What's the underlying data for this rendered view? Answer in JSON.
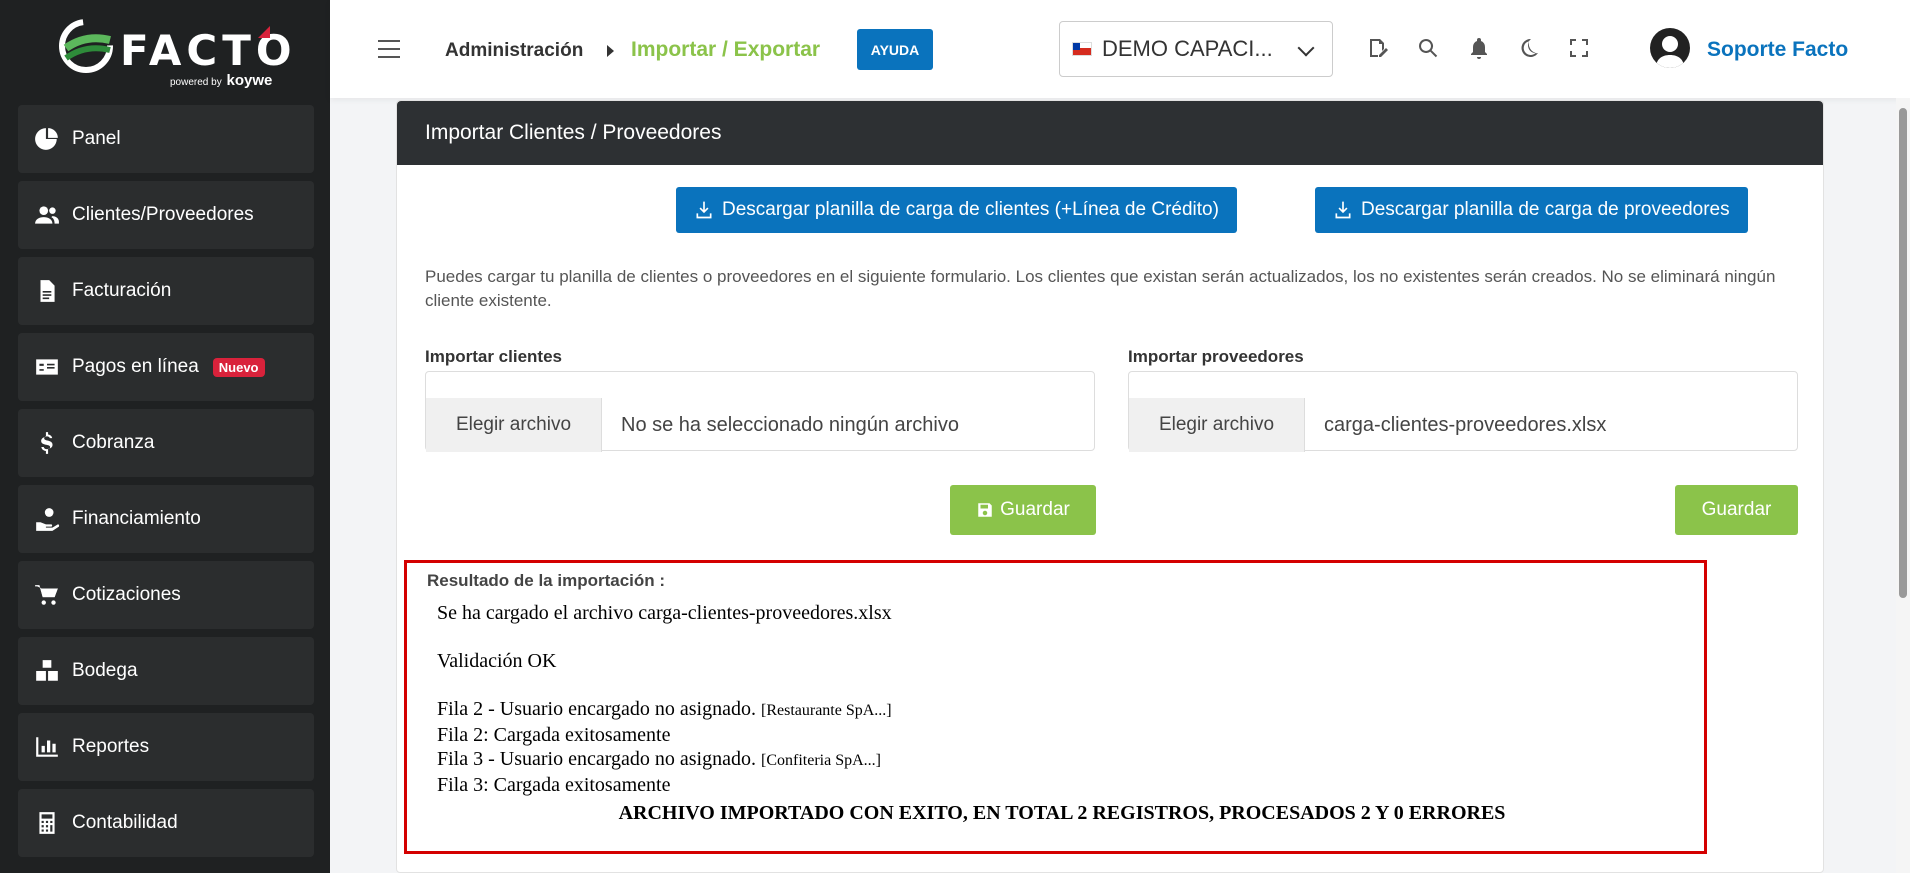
{
  "brand": {
    "name": "FACTO",
    "powered": "powered by",
    "partner": "koywe"
  },
  "sidebar": {
    "items": [
      {
        "label": "Panel",
        "icon": "pie-chart-icon"
      },
      {
        "label": "Clientes/Proveedores",
        "icon": "users-icon"
      },
      {
        "label": "Facturación",
        "icon": "document-icon"
      },
      {
        "label": "Pagos en línea",
        "icon": "payment-card-icon",
        "badge": "Nuevo"
      },
      {
        "label": "Cobranza",
        "icon": "dollar-icon"
      },
      {
        "label": "Financiamiento",
        "icon": "hand-coin-icon"
      },
      {
        "label": "Cotizaciones",
        "icon": "cart-icon"
      },
      {
        "label": "Bodega",
        "icon": "boxes-icon"
      },
      {
        "label": "Reportes",
        "icon": "bar-chart-icon"
      },
      {
        "label": "Contabilidad",
        "icon": "calculator-icon"
      }
    ]
  },
  "topbar": {
    "breadcrumb_parent": "Administración",
    "breadcrumb_current": "Importar / Exportar",
    "help_label": "AYUDA",
    "company": "DEMO CAPACI...",
    "user": "Soporte Facto"
  },
  "panel": {
    "title": "Importar Clientes / Proveedores",
    "download_clients": "Descargar planilla de carga de clientes (+Línea de Crédito)",
    "download_providers": "Descargar planilla de carga de proveedores",
    "description": "Puedes cargar tu planilla de clientes o proveedores en el siguiente formulario. Los clientes que existan serán actualizados, los no existentes serán creados. No se eliminará ningún cliente existente.",
    "clients": {
      "label": "Importar clientes",
      "button": "Elegir archivo",
      "file": "No se ha seleccionado ningún archivo",
      "save": "Guardar"
    },
    "providers": {
      "label": "Importar proveedores",
      "button": "Elegir archivo",
      "file": "carga-clientes-proveedores.xlsx",
      "save": "Guardar"
    }
  },
  "result": {
    "title": "Resultado de la importación :",
    "loaded": "Se ha cargado el archivo carga-clientes-proveedores.xlsx",
    "validation": "Validación OK",
    "row2_warning": "Fila 2 - Usuario encargado no asignado.",
    "row2_name": "[Restaurante SpA...]",
    "row2_ok": "Fila 2: Cargada exitosamente",
    "row3_warning": "Fila 3 - Usuario encargado no asignado.",
    "row3_name": "[Confiteria SpA...]",
    "row3_ok": "Fila 3: Cargada exitosamente",
    "summary": "ARCHIVO IMPORTADO CON EXITO, EN TOTAL 2 REGISTROS, PROCESADOS 2 Y 0 ERRORES"
  },
  "colors": {
    "primary": "#0a73bd",
    "success": "#8bc34a",
    "sidebar": "#1f2122",
    "error_border": "#d40000",
    "badge": "#d9223b"
  }
}
